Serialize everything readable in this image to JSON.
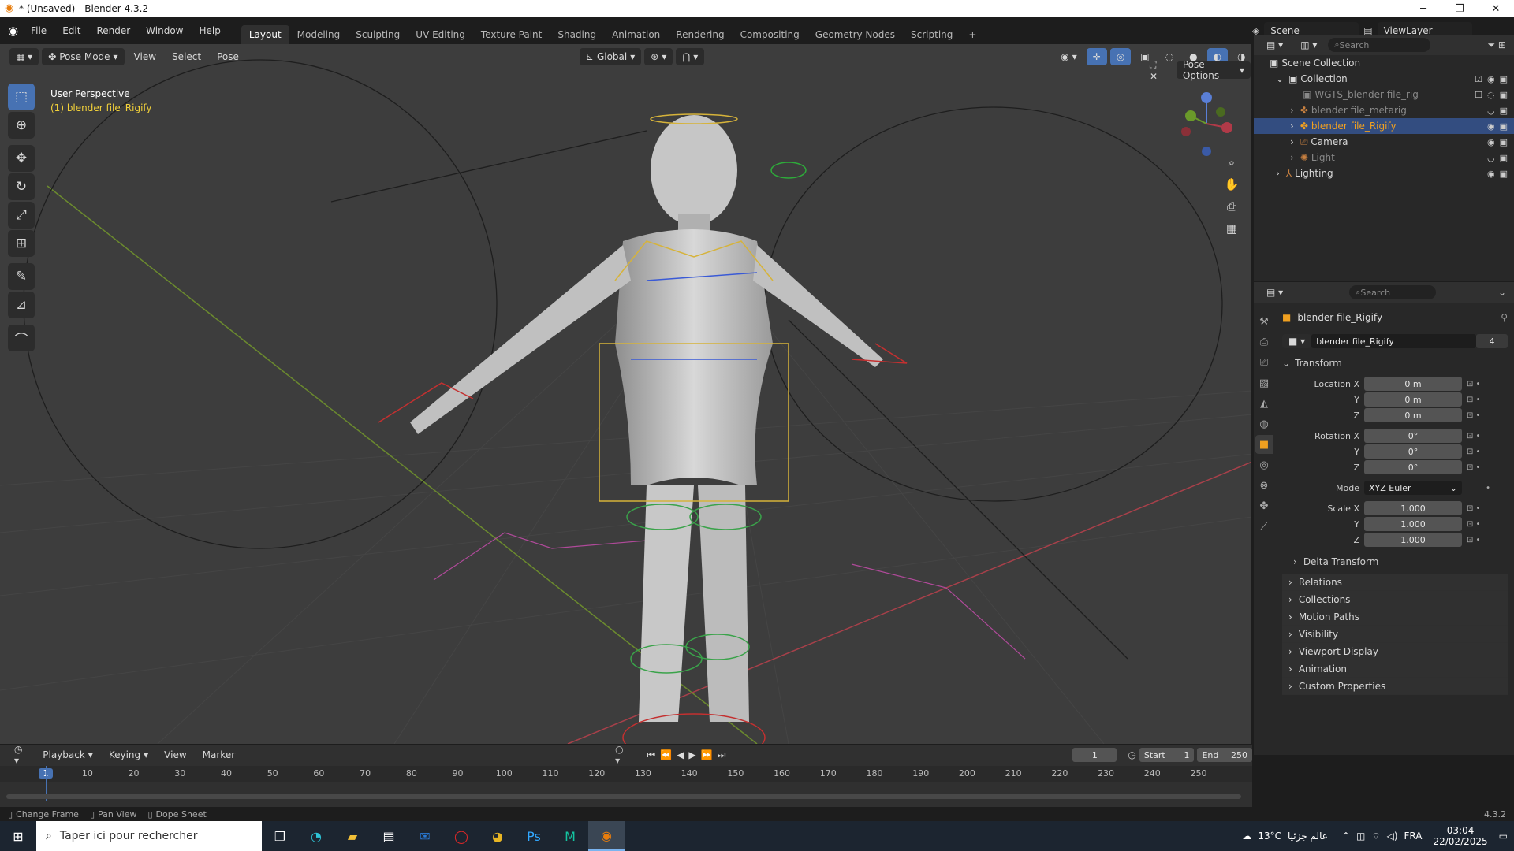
{
  "window": {
    "title": "* (Unsaved) - Blender 4.3.2"
  },
  "menus": [
    "File",
    "Edit",
    "Render",
    "Window",
    "Help"
  ],
  "workspaces": [
    "Layout",
    "Modeling",
    "Sculpting",
    "UV Editing",
    "Texture Paint",
    "Shading",
    "Animation",
    "Rendering",
    "Compositing",
    "Geometry Nodes",
    "Scripting"
  ],
  "scene": {
    "label": "Scene",
    "viewlayer": "ViewLayer"
  },
  "viewport": {
    "mode": "Pose Mode",
    "menus": [
      "View",
      "Select",
      "Pose"
    ],
    "transform_orientation": "Global",
    "pose_options": "Pose Options",
    "info_title": "User Perspective",
    "info_object": "(1) blender file_Rigify"
  },
  "outliner": {
    "search_placeholder": "Search",
    "root": "Scene Collection",
    "collection": "Collection",
    "items": [
      "WGTS_blender file_rig",
      "blender file_metarig",
      "blender file_Rigify",
      "Camera",
      "Light",
      "Lighting"
    ]
  },
  "properties": {
    "search_placeholder": "Search",
    "object_name": "blender file_Rigify",
    "datablock_name": "blender file_Rigify",
    "users": "4",
    "section_transform": "Transform",
    "location_label": "Location X",
    "rotation_label": "Rotation X",
    "scale_label": "Scale X",
    "y_label": "Y",
    "z_label": "Z",
    "mode_label": "Mode",
    "location": [
      "0 m",
      "0 m",
      "0 m"
    ],
    "rotation": [
      "0°",
      "0°",
      "0°"
    ],
    "mode_value": "XYZ Euler",
    "scale": [
      "1.000",
      "1.000",
      "1.000"
    ],
    "delta_transform": "Delta Transform",
    "panels": [
      "Relations",
      "Collections",
      "Motion Paths",
      "Visibility",
      "Viewport Display",
      "Animation",
      "Custom Properties"
    ]
  },
  "timeline": {
    "menus": [
      "Playback",
      "Keying",
      "View",
      "Marker"
    ],
    "current_frame": "1",
    "start_label": "Start",
    "start": "1",
    "end_label": "End",
    "end": "250",
    "ruler": [
      "1",
      "10",
      "20",
      "30",
      "40",
      "50",
      "60",
      "70",
      "80",
      "90",
      "100",
      "110",
      "120",
      "130",
      "140",
      "150",
      "160",
      "170",
      "180",
      "190",
      "200",
      "210",
      "220",
      "230",
      "240",
      "250"
    ]
  },
  "status": {
    "items": [
      "Change Frame",
      "Pan View",
      "Dope Sheet"
    ],
    "version": "4.3.2"
  },
  "taskbar": {
    "search_placeholder": "Taper ici pour rechercher",
    "weather": "13°C",
    "weather_text": "عالم جزئيا",
    "lang": "FRA",
    "time": "03:04",
    "date": "22/02/2025"
  },
  "colors": {
    "accent": "#4772b3",
    "selected_row": "#334d80",
    "active_object_text": "#f0a020"
  }
}
